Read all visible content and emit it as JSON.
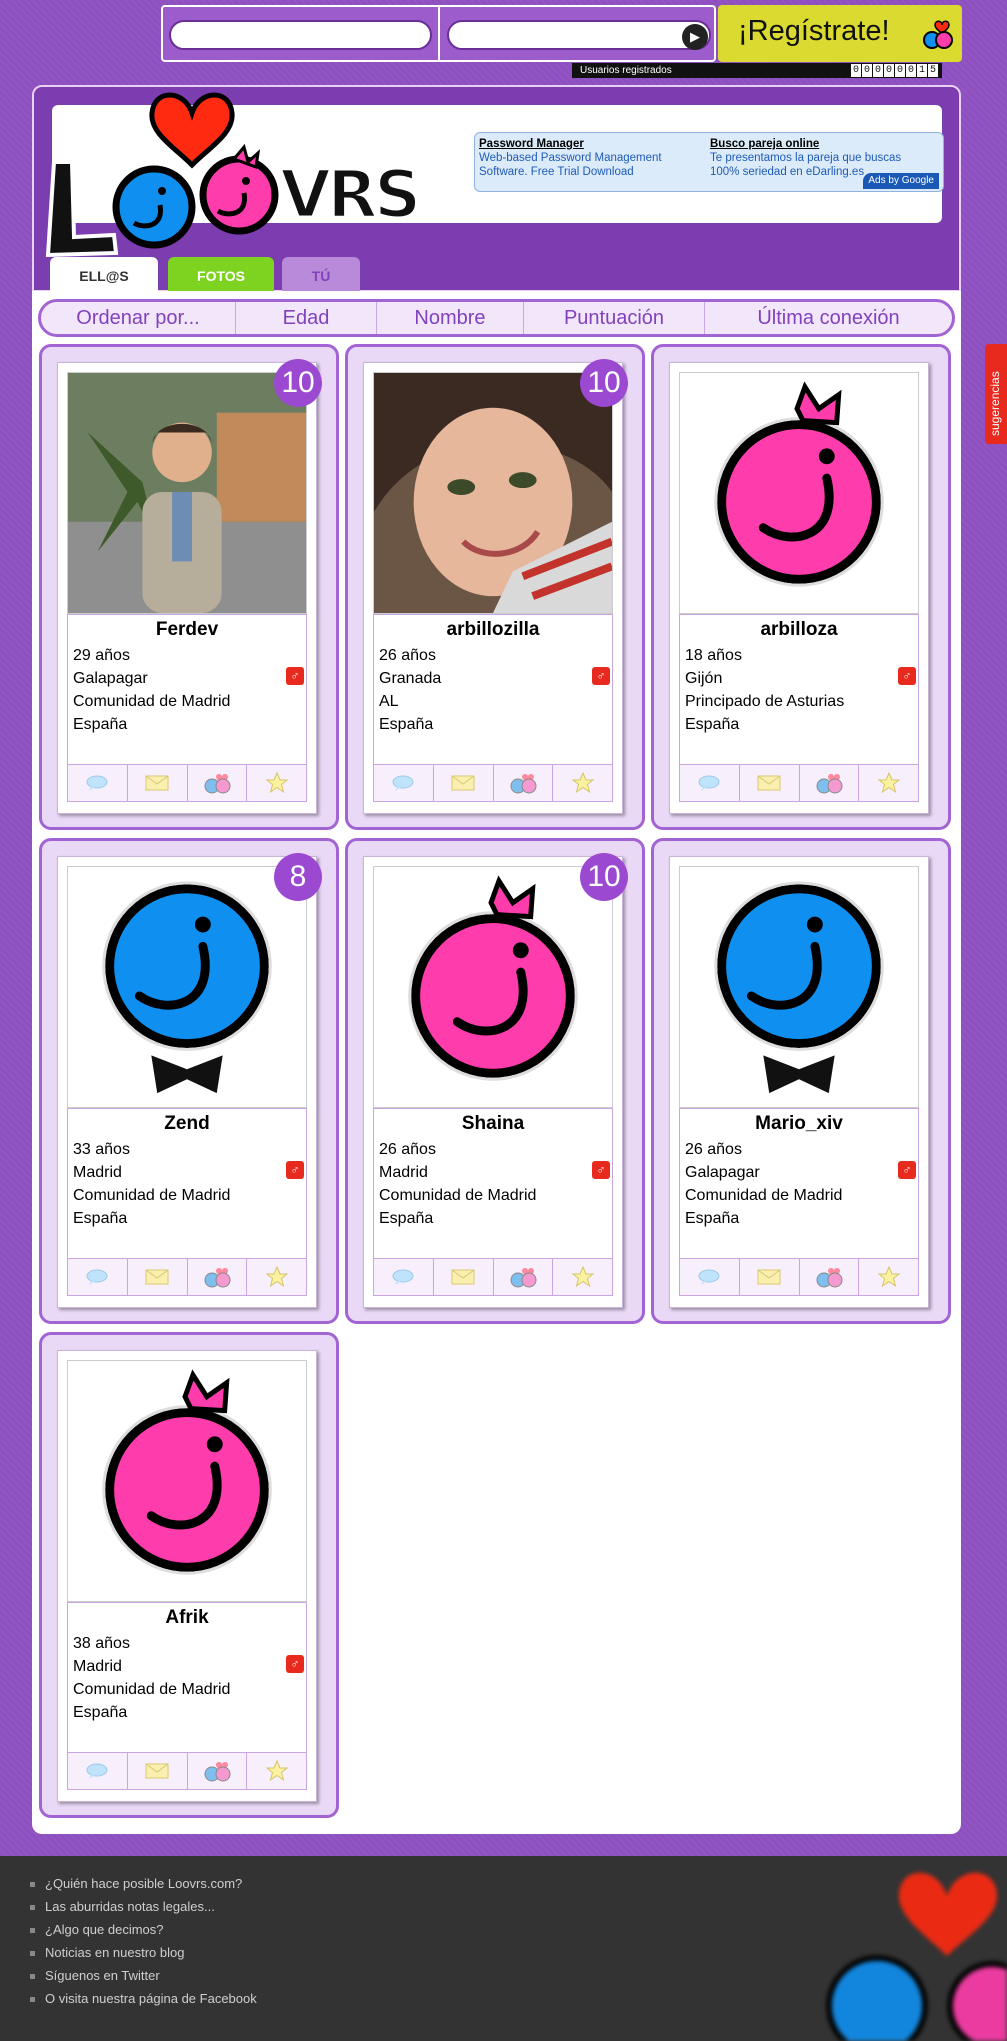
{
  "register": {
    "label": "¡Regístrate!"
  },
  "counter": {
    "label": "Usuarios registrados",
    "digits": [
      "0",
      "0",
      "0",
      "0",
      "0",
      "0",
      "1",
      "5"
    ]
  },
  "ads": [
    {
      "title": "Password Manager",
      "body": "Web-based Password Management Software. Free Trial Download"
    },
    {
      "title": "Busco pareja online",
      "body": "Te presentamos la pareja que buscas 100% seriedad en eDarling.es"
    }
  ],
  "ads_by": "Ads by Google",
  "tabs": [
    {
      "label": "ELL@S",
      "color": "#ffffff",
      "text_color": "#333333"
    },
    {
      "label": "FOTOS",
      "color": "#7ed321",
      "text_color": "#ffffff"
    },
    {
      "label": "TÚ",
      "color": "#b88ad9",
      "text_color": "#8241bd"
    }
  ],
  "sort": [
    "Ordenar por...",
    "Edad",
    "Nombre",
    "Puntuación",
    "Última conexión"
  ],
  "suggestions": "sugerencias",
  "profiles": [
    {
      "name": "Ferdev",
      "age": "29 años",
      "city": "Galapagar",
      "region": "Comunidad de Madrid",
      "country": "España",
      "score": "10",
      "avatar": "photo-man"
    },
    {
      "name": "arbillozilla",
      "age": "26 años",
      "city": "Granada",
      "region": "AL",
      "country": "España",
      "score": "10",
      "avatar": "photo-woman"
    },
    {
      "name": "arbilloza",
      "age": "18 años",
      "city": "Gijón",
      "region": "Principado de Asturias",
      "country": "España",
      "score": "",
      "avatar": "pink-face"
    },
    {
      "name": "Zend",
      "age": "33 años",
      "city": "Madrid",
      "region": "Comunidad de Madrid",
      "country": "España",
      "score": "8",
      "avatar": "blue-face"
    },
    {
      "name": "Shaina",
      "age": "26 años",
      "city": "Madrid",
      "region": "Comunidad de Madrid",
      "country": "España",
      "score": "10",
      "avatar": "pink-face"
    },
    {
      "name": "Mario_xiv",
      "age": "26 años",
      "city": "Galapagar",
      "region": "Comunidad de Madrid",
      "country": "España",
      "score": "",
      "avatar": "blue-face"
    },
    {
      "name": "Afrik",
      "age": "38 años",
      "city": "Madrid",
      "region": "Comunidad de Madrid",
      "country": "España",
      "score": "",
      "avatar": "pink-face"
    }
  ],
  "footer": [
    "¿Quién hace posible Loovrs.com?",
    "Las aburridas notas legales...",
    "¿Algo que decimos?",
    "Noticias en nuestro blog",
    "Síguenos en Twitter",
    "O visita nuestra página de Facebook"
  ],
  "colors": {
    "brand_purple": "#8e4fc0",
    "accent_pink": "#ff3cac",
    "accent_blue": "#0f8ff0",
    "heart_red": "#ff2a10"
  }
}
